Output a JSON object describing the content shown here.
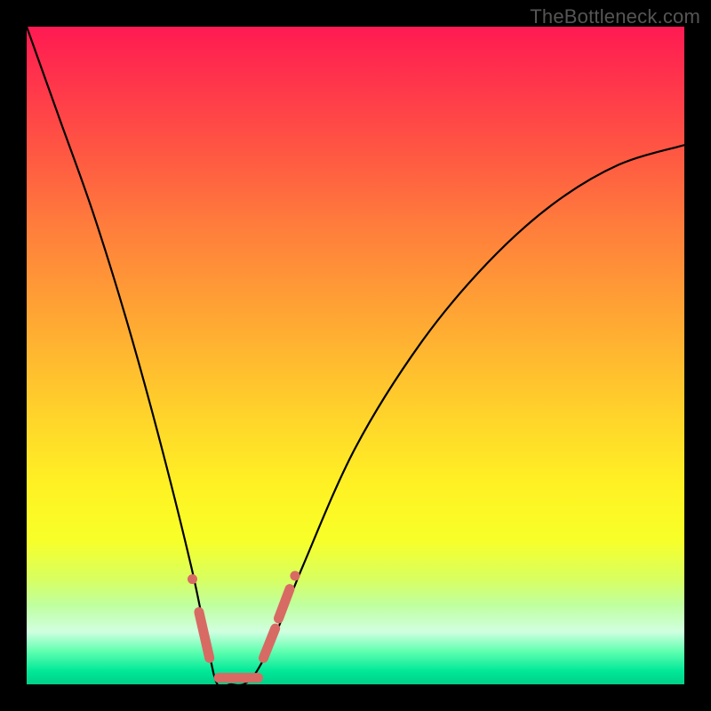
{
  "watermark": "TheBottleneck.com",
  "chart_data": {
    "type": "line",
    "title": "",
    "xlabel": "",
    "ylabel": "",
    "xlim": [
      0,
      1
    ],
    "ylim": [
      0,
      1
    ],
    "series": [
      {
        "name": "bottleneck-curve",
        "x": [
          0.0,
          0.05,
          0.1,
          0.15,
          0.2,
          0.25,
          0.275,
          0.29,
          0.31,
          0.33,
          0.35,
          0.38,
          0.42,
          0.5,
          0.6,
          0.7,
          0.8,
          0.9,
          1.0
        ],
        "y": [
          1.0,
          0.86,
          0.72,
          0.56,
          0.38,
          0.18,
          0.06,
          0.0,
          0.0,
          0.0,
          0.02,
          0.08,
          0.18,
          0.36,
          0.52,
          0.64,
          0.73,
          0.79,
          0.82
        ]
      }
    ],
    "annotations": [
      {
        "name": "left-dot-upper",
        "x": 0.252,
        "y": 0.16
      },
      {
        "name": "left-cap-lower",
        "x0": 0.262,
        "y0": 0.11,
        "x1": 0.278,
        "y1": 0.04
      },
      {
        "name": "valley-flat-cap",
        "x0": 0.292,
        "y0": 0.01,
        "x1": 0.352,
        "y1": 0.01
      },
      {
        "name": "right-cap-lower",
        "x0": 0.36,
        "y0": 0.04,
        "x1": 0.378,
        "y1": 0.085
      },
      {
        "name": "right-cap-upper",
        "x0": 0.383,
        "y0": 0.1,
        "x1": 0.4,
        "y1": 0.145
      },
      {
        "name": "right-dot-top",
        "x": 0.408,
        "y": 0.165
      }
    ],
    "background_gradient": {
      "type": "vertical",
      "stops": [
        {
          "pos": 0.0,
          "color": "#ff1a52"
        },
        {
          "pos": 0.35,
          "color": "#ff8a38"
        },
        {
          "pos": 0.7,
          "color": "#fff224"
        },
        {
          "pos": 0.92,
          "color": "#d0ffe0"
        },
        {
          "pos": 1.0,
          "color": "#00d088"
        }
      ]
    }
  }
}
